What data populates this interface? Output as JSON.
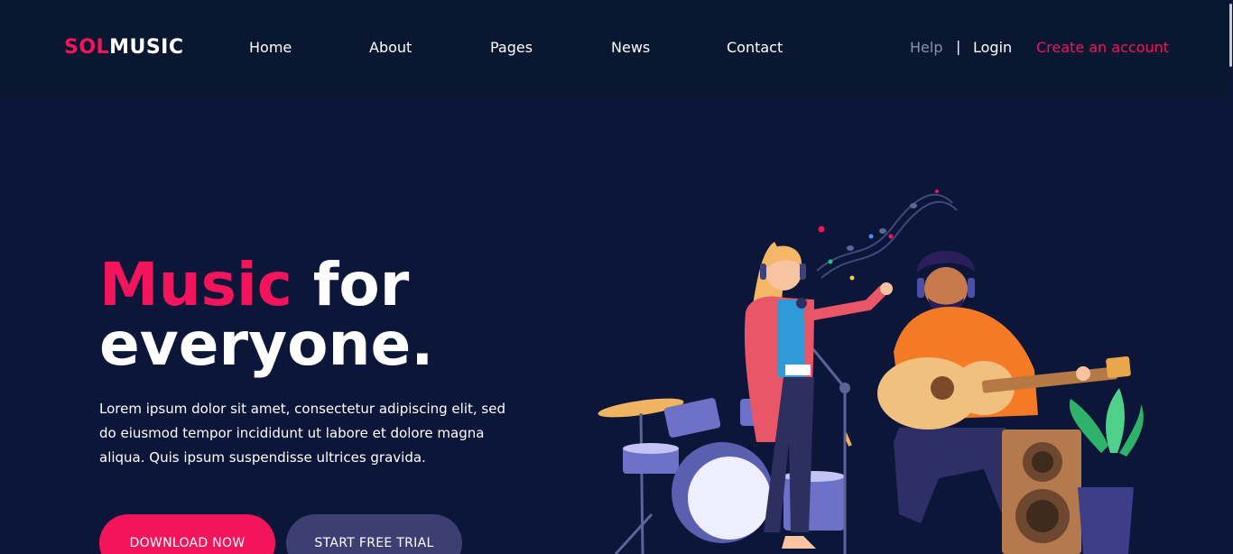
{
  "brand": {
    "logo_accent": "SOL",
    "logo_rest": "MUSIC",
    "accent_color": "#f2155b"
  },
  "nav": {
    "items": [
      "Home",
      "About",
      "Pages",
      "News",
      "Contact"
    ],
    "help": "Help",
    "separator": "|",
    "login": "Login",
    "create_account": "Create an account"
  },
  "hero": {
    "title_accent": "Music",
    "title_rest_1": "for",
    "title_line_2": "everyone.",
    "description": "Lorem ipsum dolor sit amet, consectetur adipiscing elit, sed do eiusmod tempor incididunt ut labore et dolore magna aliqua. Quis ipsum suspendisse ultrices gravida.",
    "download_label": "DOWNLOAD NOW",
    "trial_label": "START FREE TRIAL"
  },
  "illustration": {
    "icons": [
      "music-notes-icon",
      "singer-illustration",
      "guitarist-illustration",
      "drum-kit-illustration",
      "speaker-illustration",
      "plant-illustration"
    ]
  }
}
